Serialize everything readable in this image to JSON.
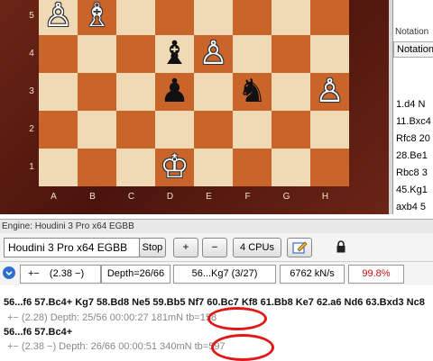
{
  "board": {
    "ranks": [
      "5",
      "4",
      "3",
      "2",
      "1"
    ],
    "files": [
      "A",
      "B",
      "C",
      "D",
      "E",
      "F",
      "G",
      "H"
    ],
    "pieces": {
      "a5": "♙",
      "b5": "♗",
      "d4": "♝",
      "e4": "♙",
      "d3": "♟",
      "f3": "♞",
      "h3": "♙",
      "d1": "♔"
    }
  },
  "notation": {
    "tab1": "Notation",
    "tab2": "Notation",
    "lines": [
      "1.d4 N",
      "11.Bxc4",
      "Rfc8 20",
      "28.Be1",
      "Rbc8 3",
      "45.Kg1",
      "axb4 5"
    ]
  },
  "engine": {
    "title": "Engine: Houdini 3 Pro x64 EGBB",
    "name": "Houdini 3 Pro x64 EGBB",
    "stop_label": "Stop",
    "plus_label": "+",
    "minus_label": "−",
    "cpus_label": "4 CPUs",
    "eval": "+−",
    "eval_value": "(2.38 −)",
    "depth": "Depth=26/66",
    "current_move": "56...Kg7 (3/27)",
    "speed": "6762 kN/s",
    "percent": "99.8%"
  },
  "analysis": {
    "line1_moves": "56...f6 57.Bc4+ Kg7 58.Bd8 Ne5 59.Bb5 Nf7 60.Bc7 Kf8 61.Bb8 Ke7 62.a6 Nd6 63.Bxd3 Nc8",
    "line1_info": "+−  (2.28)  Depth: 25/56   00:00:27  181mN  tb=158",
    "line2_moves": "56...f6 57.Bc4+",
    "line2_info": "+−  (2.38 −)  Depth: 26/66   00:00:51  340mN  tb=597"
  },
  "colors": {
    "accent": "#e01818",
    "dark_square": "#c9652a",
    "light_square": "#f0d9b5"
  }
}
